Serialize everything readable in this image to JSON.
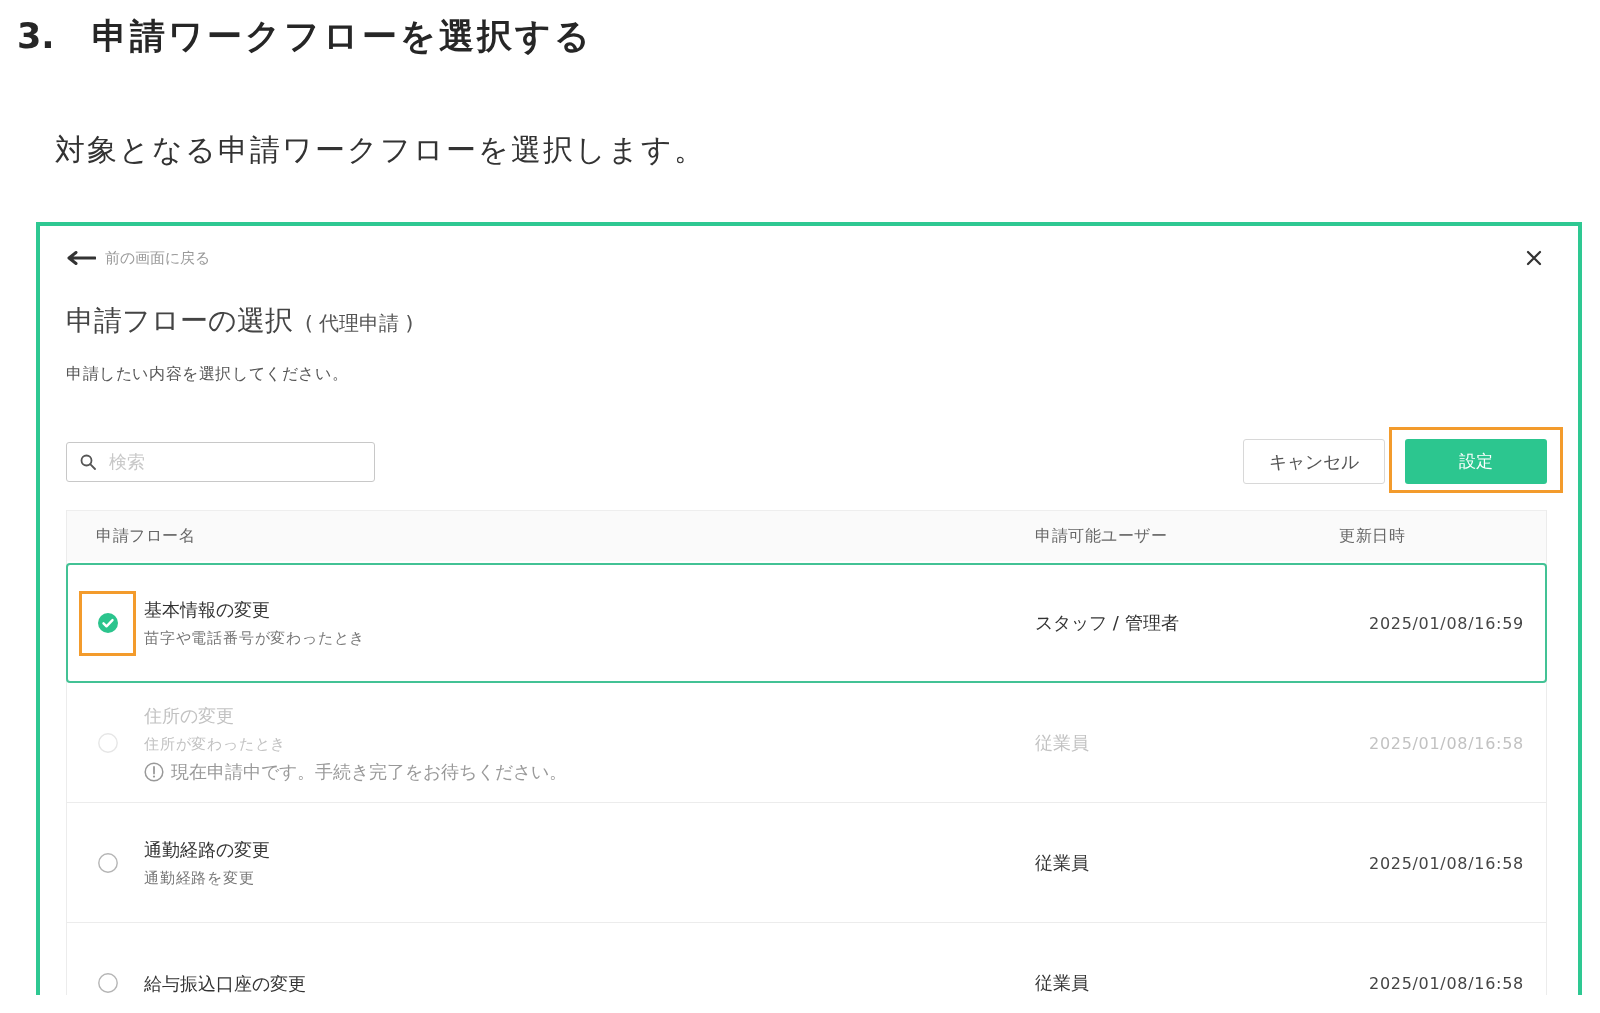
{
  "heading": {
    "number": "3.",
    "title": "申請ワークフローを選択する"
  },
  "intro": "対象となる申請ワークフローを選択します。",
  "dialog": {
    "back_link": "前の画面に戻る",
    "title": "申請フローの選択",
    "title_note": "( 代理申請 )",
    "description": "申請したい内容を選択してください。",
    "search": {
      "placeholder": "検索"
    },
    "buttons": [
      {
        "label": "キャンセル",
        "kind": "secondary",
        "highlighted": false
      },
      {
        "label": "設定",
        "kind": "primary",
        "highlighted": true
      }
    ],
    "table": {
      "columns": [
        "申請フロー名",
        "申請可能ユーザー",
        "更新日時"
      ],
      "rows": [
        {
          "name": "基本情報の変更",
          "description": "苗字や電話番号が変わったとき",
          "users": "スタッフ / 管理者",
          "updated": "2025/01/08/16:59",
          "selected": true,
          "disabled": false,
          "highlighted": true
        },
        {
          "name": "住所の変更",
          "description": "住所が変わったとき",
          "notice": "現在申請中です。手続き完了をお待ちください。",
          "users": "従業員",
          "updated": "2025/01/08/16:58",
          "selected": false,
          "disabled": true,
          "highlighted": false
        },
        {
          "name": "通勤経路の変更",
          "description": "通勤経路を変更",
          "users": "従業員",
          "updated": "2025/01/08/16:58",
          "selected": false,
          "disabled": false,
          "highlighted": false
        },
        {
          "name": "給与振込口座の変更",
          "users": "従業員",
          "updated": "2025/01/08/16:58",
          "selected": false,
          "disabled": false,
          "highlighted": false
        }
      ]
    }
  }
}
